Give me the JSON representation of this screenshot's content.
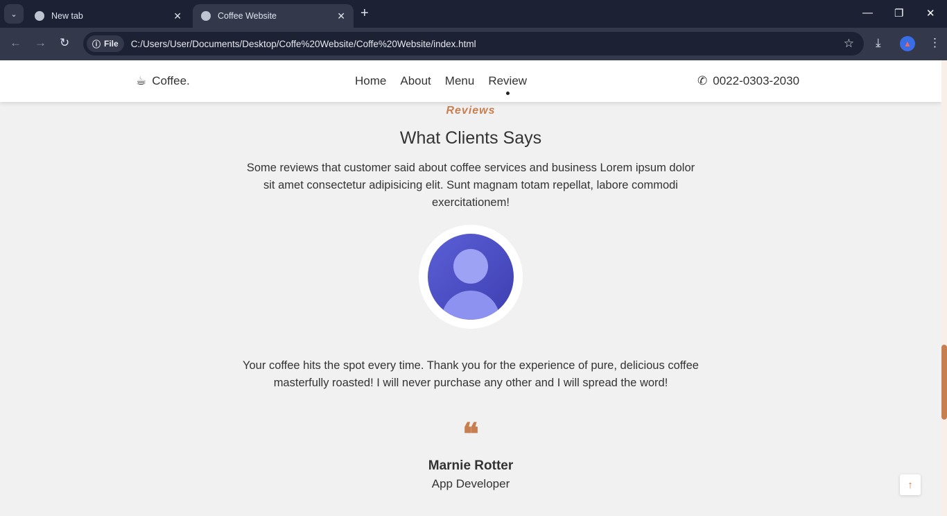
{
  "browser": {
    "tabs": [
      {
        "label": "New tab",
        "close": "✕"
      },
      {
        "label": "Coffee Website",
        "close": "✕"
      }
    ],
    "new_tab": "+",
    "window_controls": {
      "minimize": "—",
      "restore": "❐",
      "close": "✕"
    },
    "chip": "File",
    "url": "C:/Users/User/Documents/Desktop/Coffe%20Website/Coffe%20Website/index.html"
  },
  "header": {
    "logo": "Coffee.",
    "menu": [
      "Home",
      "About",
      "Menu",
      "Review"
    ],
    "active": "Review",
    "phone": "0022-0303-2030"
  },
  "reviews": {
    "eyebrow": "Reviews",
    "title": "What Clients Says",
    "description": "Some reviews that customer said about coffee services and business Lorem ipsum dolor sit amet consectetur adipisicing elit. Sunt magnam totam repellat, labore commodi exercitationem!",
    "quote": "Your coffee hits the spot every time. Thank you for the experience of pure, delicious coffee masterfully roasted! I will never purchase any other and I will spread the word!",
    "quote_mark": "❝",
    "name": "Marnie Rotter",
    "role": "App Developer"
  },
  "colors": {
    "accent": "#c87f4f",
    "bg": "#f1f1f1"
  },
  "scrollbar": {
    "position_fraction": 0.8
  }
}
